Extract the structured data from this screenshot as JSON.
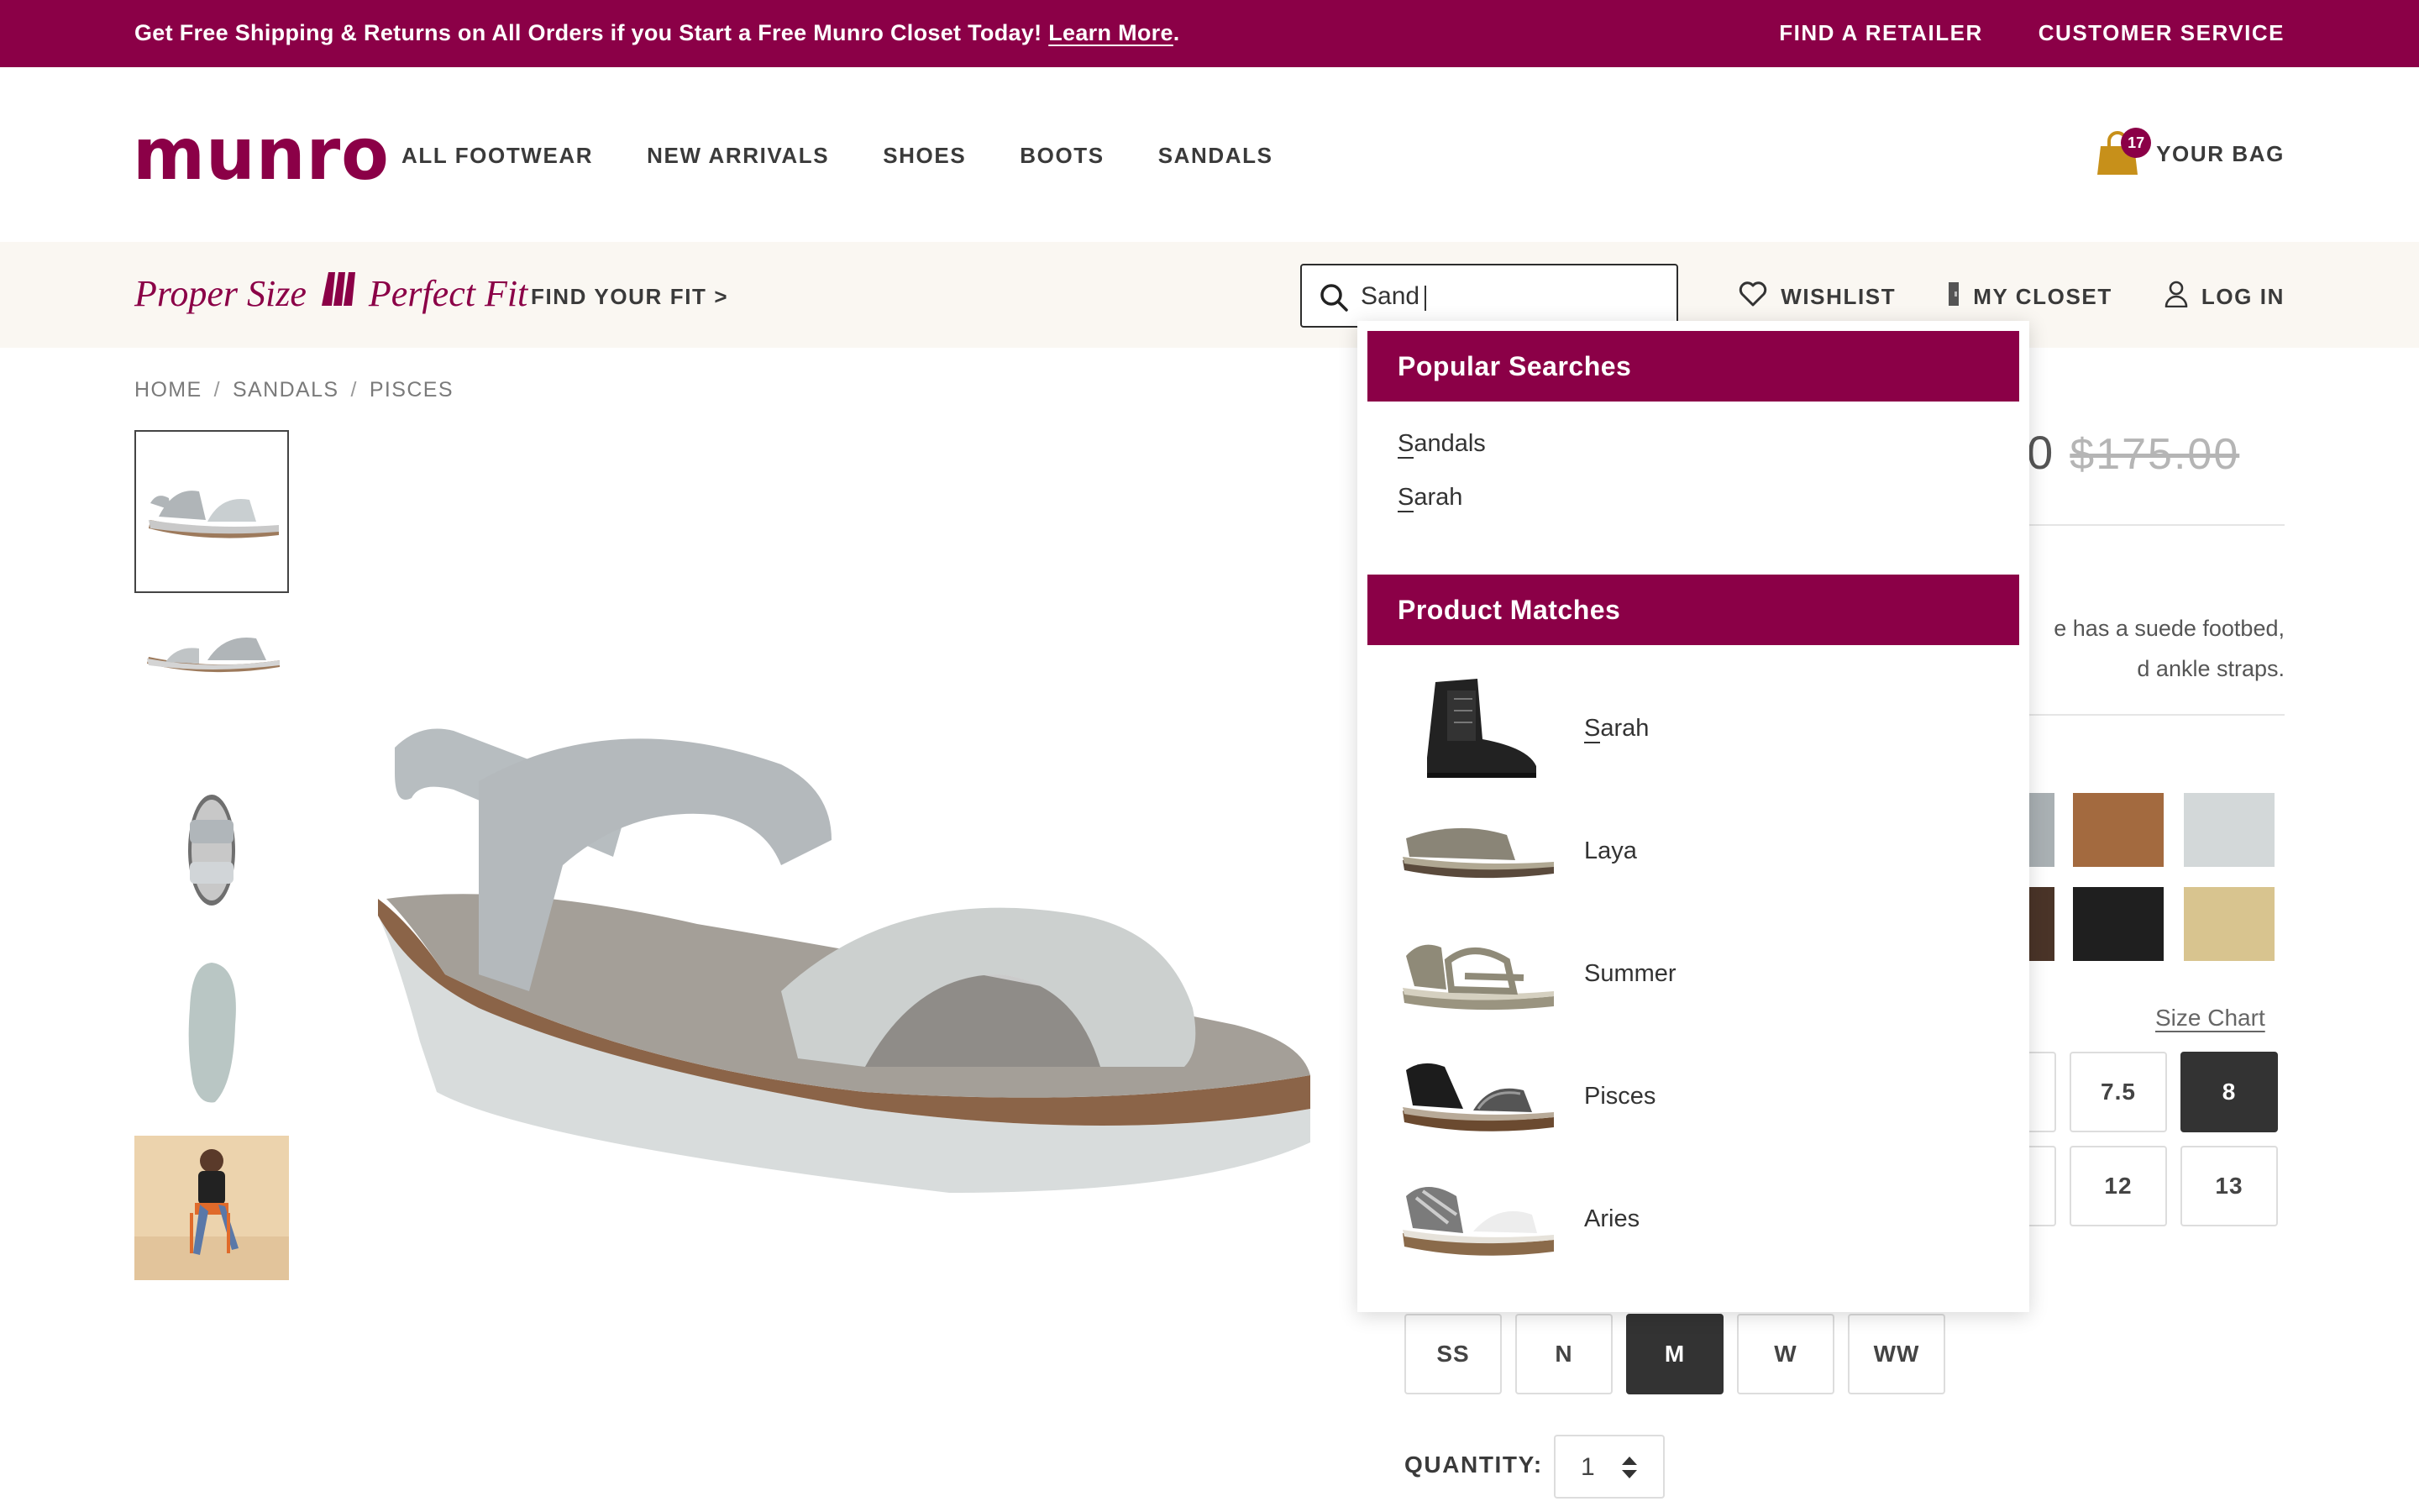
{
  "promo": {
    "message": "Get Free Shipping & Returns on All Orders if you Start a Free Munro Closet Today!",
    "link": "Learn More",
    "period": ".",
    "find_retailer": "FIND A RETAILER",
    "customer_service": "CUSTOMER SERVICE"
  },
  "header": {
    "logo": "munro",
    "nav": [
      "ALL FOOTWEAR",
      "NEW ARRIVALS",
      "SHOES",
      "BOOTS",
      "SANDALS"
    ],
    "bag_count": "17",
    "bag_label": "YOUR BAG"
  },
  "fitbar": {
    "tagline_left": "Proper Size",
    "tagline_right": "Perfect Fit",
    "find_fit": "FIND YOUR FIT >",
    "search_value": "Sand",
    "wishlist": "WISHLIST",
    "my_closet": "MY CLOSET",
    "log_in": "LOG IN"
  },
  "breadcrumb": [
    "HOME",
    "SANDALS",
    "PISCES"
  ],
  "product": {
    "price_visible": "00",
    "original_price": "$175.00",
    "desc_line1": "e has a suede footbed,",
    "desc_line2": "d ankle straps.",
    "size_chart": "Size Chart",
    "sizes_visible": [
      "7.5",
      "8",
      "12",
      "13"
    ],
    "selected_size": "8",
    "widths": [
      "SS",
      "N",
      "M",
      "W",
      "WW"
    ],
    "selected_width": "M",
    "quantity_label": "QUANTITY:",
    "quantity": "1"
  },
  "dropdown": {
    "popular_title": "Popular Searches",
    "popular": [
      {
        "match": "S",
        "rest": "andals"
      },
      {
        "match": "S",
        "rest": "arah"
      }
    ],
    "matches_title": "Product Matches",
    "matches": [
      {
        "name": "Sarah",
        "underline": true
      },
      {
        "name": "Laya",
        "underline": false
      },
      {
        "name": "Summer",
        "underline": false
      },
      {
        "name": "Pisces",
        "underline": false
      },
      {
        "name": "Aries",
        "underline": false
      }
    ]
  },
  "colors": {
    "brand": "#8b0047",
    "dark": "#333333",
    "bag": "#c7901a"
  }
}
